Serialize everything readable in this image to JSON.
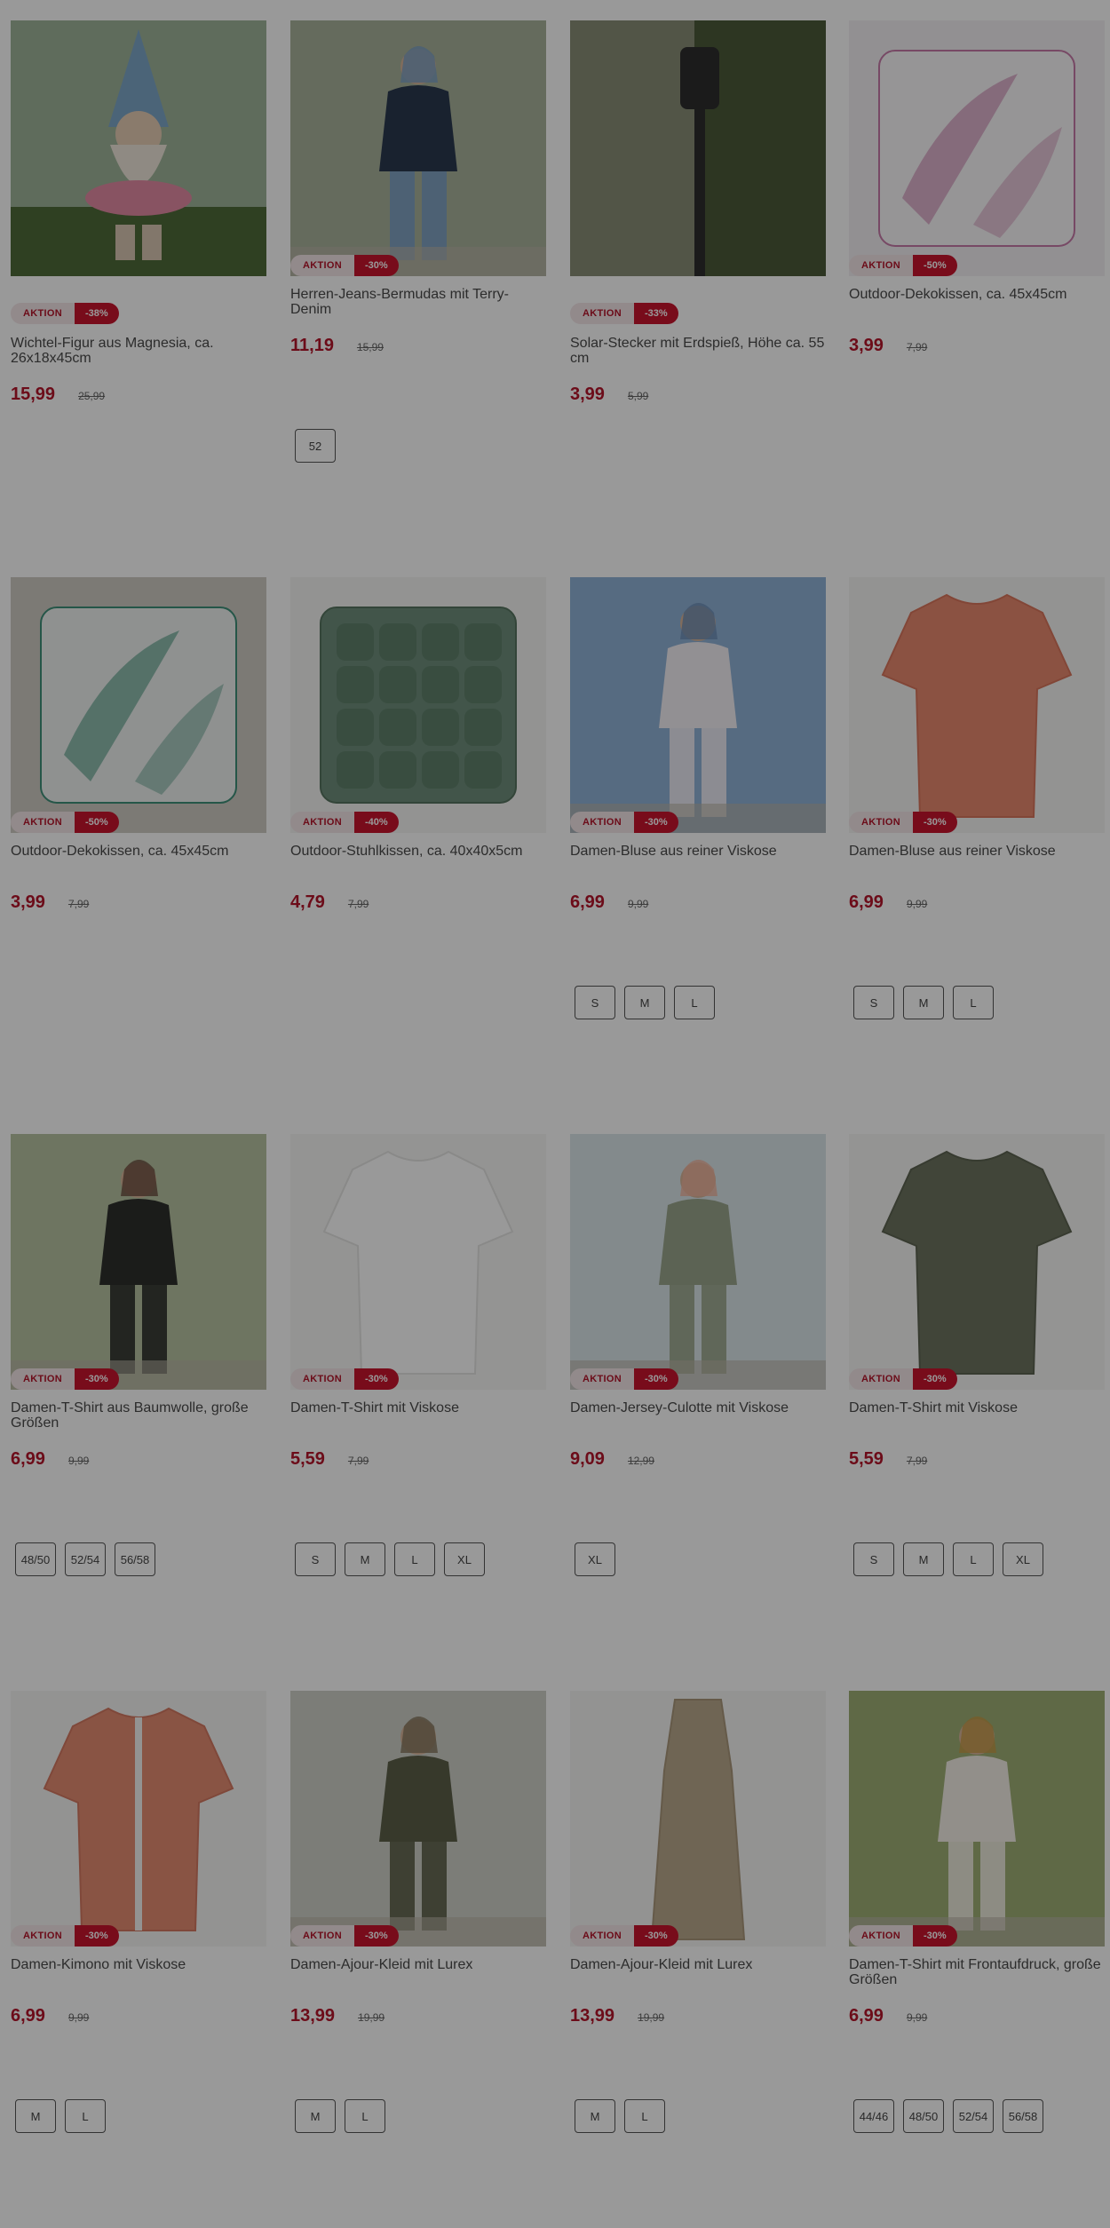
{
  "products": [
    {
      "title": "Wichtel-Figur aus Magnesia, ca. 26x18x45cm",
      "badge": "AKTION",
      "discount": "-38%",
      "price": "15,99",
      "old_price": "25,99",
      "sizes": [],
      "badge_pos": "below",
      "image": "garden-gnome-figure",
      "colors": {
        "bg": "#9fb59a",
        "main": "#7ea7c8",
        "accent": "#e38aa3"
      }
    },
    {
      "title": "Herren-Jeans-Bermudas mit Terry-Denim",
      "badge": "AKTION",
      "discount": "-30%",
      "price": "11,19",
      "old_price": "15,99",
      "sizes": [
        "52"
      ],
      "badge_pos": "overlay",
      "image": "man-in-denim-shorts",
      "colors": {
        "bg": "#a9b29c",
        "main": "#2b3a4f",
        "accent": "#7ba0c5"
      }
    },
    {
      "title": "Solar-Stecker mit Erdspieß, Höhe ca. 55 cm",
      "badge": "AKTION",
      "discount": "-33%",
      "price": "3,99",
      "old_price": "5,99",
      "sizes": [],
      "badge_pos": "below",
      "image": "solar-garden-light",
      "colors": {
        "bg": "#4b5a3a",
        "main": "#2e2e2e",
        "accent": "#c8c2b4"
      }
    },
    {
      "title": "Outdoor-Dekokissen, ca. 45x45cm",
      "badge": "AKTION",
      "discount": "-50%",
      "price": "3,99",
      "old_price": "7,99",
      "sizes": [],
      "badge_pos": "overlay",
      "image": "floral-cushion-pink",
      "colors": {
        "bg": "#f3f1f4",
        "main": "#faf8fa",
        "accent": "#c77aa8"
      }
    },
    {
      "title": "Outdoor-Dekokissen, ca. 45x45cm",
      "badge": "AKTION",
      "discount": "-50%",
      "price": "3,99",
      "old_price": "7,99",
      "sizes": [],
      "badge_pos": "overlay",
      "image": "tropical-cushion",
      "colors": {
        "bg": "#cfcbc4",
        "main": "#eef2f0",
        "accent": "#3f8f79"
      }
    },
    {
      "title": "Outdoor-Stuhlkissen, ca. 40x40x5cm",
      "badge": "AKTION",
      "discount": "-40%",
      "price": "4,79",
      "old_price": "7,99",
      "sizes": [],
      "badge_pos": "overlay",
      "image": "green-seat-cushion",
      "colors": {
        "bg": "#f5f5f3",
        "main": "#6e8e7c",
        "accent": "#56745f"
      }
    },
    {
      "title": "Damen-Bluse aus reiner Viskose",
      "badge": "AKTION",
      "discount": "-30%",
      "price": "6,99",
      "old_price": "9,99",
      "sizes": [
        "S",
        "M",
        "L"
      ],
      "badge_pos": "overlay",
      "image": "woman-white-blouse",
      "colors": {
        "bg": "#8fb2d8",
        "main": "#f4f0f6",
        "accent": "#6c8cb5"
      }
    },
    {
      "title": "Damen-Bluse aus reiner Viskose",
      "badge": "AKTION",
      "discount": "-30%",
      "price": "6,99",
      "old_price": "9,99",
      "sizes": [
        "S",
        "M",
        "L"
      ],
      "badge_pos": "overlay",
      "image": "coral-blouse",
      "colors": {
        "bg": "#f6f5f3",
        "main": "#e8896e",
        "accent": "#d9765c"
      }
    },
    {
      "title": "Damen-T-Shirt aus Baumwolle, große Größen",
      "badge": "AKTION",
      "discount": "-30%",
      "price": "6,99",
      "old_price": "9,99",
      "sizes": [
        "48/50",
        "52/54",
        "56/58"
      ],
      "badge_pos": "overlay",
      "image": "woman-dark-tshirt",
      "colors": {
        "bg": "#b7c3a2",
        "main": "#2d302c",
        "accent": "#6a4e3e"
      }
    },
    {
      "title": "Damen-T-Shirt mit Viskose",
      "badge": "AKTION",
      "discount": "-30%",
      "price": "5,59",
      "old_price": "7,99",
      "sizes": [
        "S",
        "M",
        "L",
        "XL"
      ],
      "badge_pos": "overlay",
      "image": "white-tshirt",
      "colors": {
        "bg": "#f7f7f6",
        "main": "#ffffff",
        "accent": "#e5e5e3"
      }
    },
    {
      "title": "Damen-Jersey-Culotte mit Viskose",
      "badge": "AKTION",
      "discount": "-30%",
      "price": "9,09",
      "old_price": "12,99",
      "sizes": [
        "XL"
      ],
      "badge_pos": "overlay",
      "image": "woman-culotte",
      "colors": {
        "bg": "#dbe6ea",
        "main": "#9aa58c",
        "accent": "#f1b59d"
      }
    },
    {
      "title": "Damen-T-Shirt mit Viskose",
      "badge": "AKTION",
      "discount": "-30%",
      "price": "5,59",
      "old_price": "7,99",
      "sizes": [
        "S",
        "M",
        "L",
        "XL"
      ],
      "badge_pos": "overlay",
      "image": "olive-tshirt",
      "colors": {
        "bg": "#f7f7f6",
        "main": "#6d7460",
        "accent": "#5c6351"
      }
    },
    {
      "title": "Damen-Kimono mit Viskose",
      "badge": "AKTION",
      "discount": "-30%",
      "price": "6,99",
      "old_price": "9,99",
      "sizes": [
        "M",
        "L"
      ],
      "badge_pos": "overlay",
      "image": "coral-kimono",
      "colors": {
        "bg": "#f6f5f3",
        "main": "#e48c72",
        "accent": "#d47861"
      }
    },
    {
      "title": "Damen-Ajour-Kleid mit Lurex",
      "badge": "AKTION",
      "discount": "-30%",
      "price": "13,99",
      "old_price": "19,99",
      "sizes": [
        "M",
        "L"
      ],
      "badge_pos": "overlay",
      "image": "woman-olive-dress",
      "colors": {
        "bg": "#cfd0c8",
        "main": "#5c5f48",
        "accent": "#83765c"
      }
    },
    {
      "title": "Damen-Ajour-Kleid mit Lurex",
      "badge": "AKTION",
      "discount": "-30%",
      "price": "13,99",
      "old_price": "19,99",
      "sizes": [
        "M",
        "L"
      ],
      "badge_pos": "overlay",
      "image": "beige-dress",
      "colors": {
        "bg": "#f6f5f3",
        "main": "#b9a88c",
        "accent": "#a8977b"
      }
    },
    {
      "title": "Damen-T-Shirt mit Frontaufdruck, große Größen",
      "badge": "AKTION",
      "discount": "-30%",
      "price": "6,99",
      "old_price": "9,99",
      "sizes": [
        "44/46",
        "48/50",
        "52/54",
        "56/58"
      ],
      "badge_pos": "overlay",
      "image": "woman-print-tshirt",
      "colors": {
        "bg": "#9fb076",
        "main": "#f3efe6",
        "accent": "#c79a46"
      }
    }
  ]
}
